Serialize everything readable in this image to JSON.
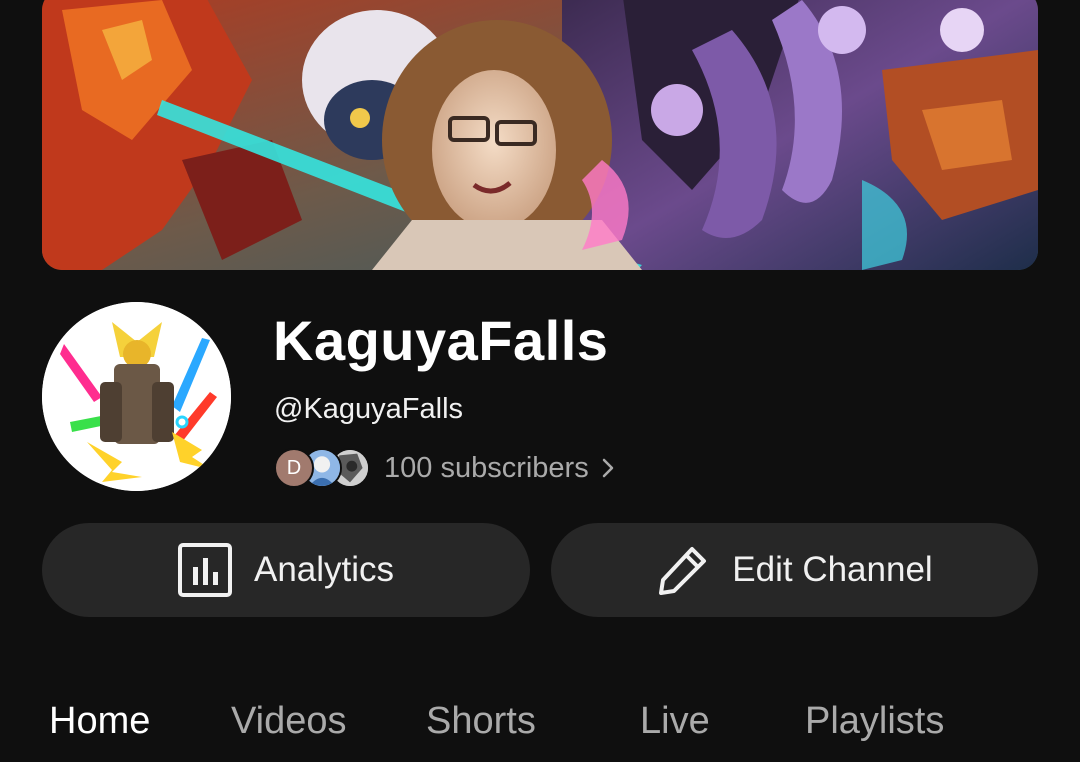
{
  "channel": {
    "name": "KaguyaFalls",
    "handle": "@KaguyaFalls",
    "subscribers": "100 subscribers",
    "subscriber_avatar_initial": "D"
  },
  "actions": {
    "analytics_label": "Analytics",
    "edit_label": "Edit Channel"
  },
  "tabs": [
    {
      "label": "Home",
      "active": true
    },
    {
      "label": "Videos",
      "active": false
    },
    {
      "label": "Shorts",
      "active": false
    },
    {
      "label": "Live",
      "active": false
    },
    {
      "label": "Playlists",
      "active": false
    }
  ],
  "icons": {
    "analytics": "bar-chart-icon",
    "edit": "pencil-icon",
    "subscribers_more": "chevron-right-icon"
  },
  "colors": {
    "background": "#0f0f0f",
    "button": "#272727",
    "primary_text": "#f1f1f1",
    "secondary_text": "#aaaaaa"
  }
}
